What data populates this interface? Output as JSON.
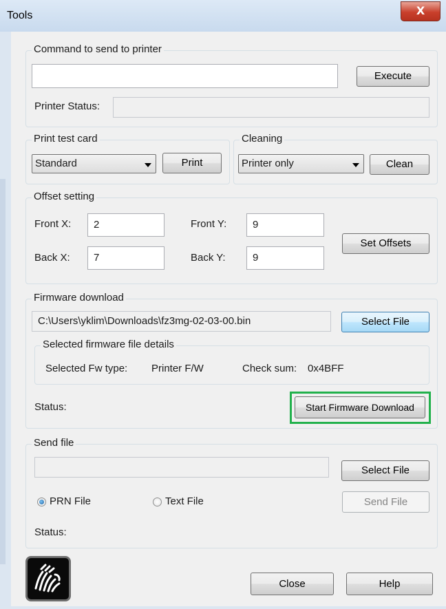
{
  "window": {
    "title": "Tools",
    "close_glyph": "X"
  },
  "command_group": {
    "legend": "Command to send to printer",
    "command_value": "",
    "execute_label": "Execute",
    "status_label": "Printer Status:",
    "status_value": ""
  },
  "test_card_group": {
    "legend": "Print test card",
    "selected": "Standard",
    "print_label": "Print"
  },
  "cleaning_group": {
    "legend": "Cleaning",
    "selected": "Printer only",
    "clean_label": "Clean"
  },
  "offset_group": {
    "legend": "Offset setting",
    "front_x_label": "Front X:",
    "front_x_value": "2",
    "front_y_label": "Front Y:",
    "front_y_value": "9",
    "back_x_label": "Back X:",
    "back_x_value": "7",
    "back_y_label": "Back Y:",
    "back_y_value": "9",
    "set_offsets_label": "Set Offsets"
  },
  "firmware_group": {
    "legend": "Firmware download",
    "file_path": "C:\\Users\\yklim\\Downloads\\fz3mg-02-03-00.bin",
    "select_file_label": "Select File",
    "details_legend": "Selected firmware file details",
    "fw_type_label": "Selected Fw type:",
    "fw_type_value": "Printer F/W",
    "checksum_label": "Check sum:",
    "checksum_value": "0x4BFF",
    "status_label": "Status:",
    "start_label": "Start Firmware Download",
    "highlight_color": "#22b14c"
  },
  "send_file_group": {
    "legend": "Send file",
    "file_path": "",
    "select_file_label": "Select File",
    "prn_label": "PRN File",
    "text_label": "Text File",
    "prn_selected": true,
    "send_label": "Send File",
    "status_label": "Status:"
  },
  "footer": {
    "logo_icon": "zebra-logo-icon",
    "close_label": "Close",
    "help_label": "Help"
  }
}
